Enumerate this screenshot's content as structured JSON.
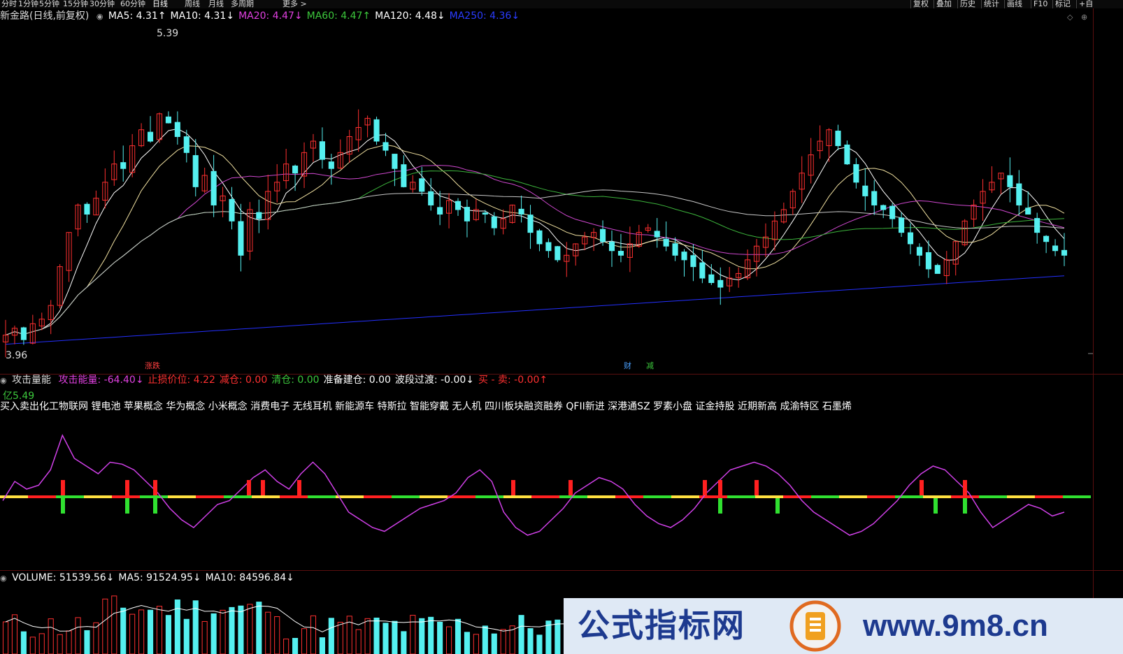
{
  "topbar": {
    "periods": [
      "分时",
      "1分钟",
      "5分钟",
      "15分钟",
      "30分钟",
      "60分钟",
      "日线",
      "周线",
      "月线",
      "多周期",
      "更多 >"
    ],
    "active_period": "日线",
    "right_buttons": [
      "复权",
      "叠加",
      "历史",
      "统计",
      "画线",
      "F10",
      "标记",
      "+自"
    ]
  },
  "main_panel": {
    "title": "新金路(日线,前复权)",
    "indicators": [
      {
        "label": "MA5: 4.31",
        "arrow": "↑",
        "color": "#ffffff"
      },
      {
        "label": "MA10: 4.31",
        "arrow": "↓",
        "color": "#ffffff"
      },
      {
        "label": "MA20: 4.47",
        "arrow": "↓",
        "color": "#e040e0"
      },
      {
        "label": "MA60: 4.47",
        "arrow": "↑",
        "color": "#3cc83c"
      },
      {
        "label": "MA120: 4.48",
        "arrow": "↓",
        "color": "#ffffff"
      },
      {
        "label": "MA250: 4.36",
        "arrow": "↓",
        "color": "#2a3cff"
      }
    ],
    "high_label": "5.39",
    "low_label": "3.96",
    "markers": [
      {
        "text": "涨跌",
        "color": "#ff4040"
      },
      {
        "text": "财",
        "color": "#4aa0ff"
      },
      {
        "text": "减",
        "color": "#3cc83c"
      }
    ]
  },
  "indicator_panel": {
    "name": "攻击量能",
    "items": [
      {
        "label": "攻击能量: -64.40",
        "arrow": "↓",
        "color": "#e040e0"
      },
      {
        "label": "止损价位: 4.22",
        "arrow": "",
        "color": "#ff3030"
      },
      {
        "label": "减仓: 0.00",
        "arrow": "",
        "color": "#ff3030"
      },
      {
        "label": "清仓: 0.00",
        "arrow": "",
        "color": "#3cc83c"
      },
      {
        "label": "准备建仓: 0.00",
        "arrow": "",
        "color": "#ffffff"
      },
      {
        "label": "波段过渡: -0.00",
        "arrow": "↓",
        "color": "#ffffff"
      },
      {
        "label": "买 - 卖: -0.00",
        "arrow": "↑",
        "color": "#ff3030"
      }
    ],
    "concepts": "买入卖出化工物联网 锂电池 苹果概念 华为概念 小米概念 消费电子 无线耳机 新能源车 特斯拉 智能穿戴 无人机 四川板块融资融券 QFII新进 深港通SZ 罗素小盘 证金持股 近期新高 成渝特区 石墨烯",
    "scale_label": "亿5.49"
  },
  "volume_panel": {
    "items": [
      {
        "label": "VOLUME: 51539.56",
        "arrow": "↓",
        "color": "#ffffff"
      },
      {
        "label": "MA5: 91524.95",
        "arrow": "↓",
        "color": "#ffffff"
      },
      {
        "label": "MA10: 84596.84",
        "arrow": "↓",
        "color": "#ffffff"
      }
    ]
  },
  "watermark": {
    "left_text": "公式指标网",
    "right_text": "www.9m8.cn"
  },
  "colors": {
    "up": "#ff3030",
    "down": "#55f0f0",
    "ma5": "#ffffff",
    "ma10": "#f0e0a0",
    "ma20": "#d048d0",
    "ma60": "#3cb43c",
    "ma120": "#c8c8c8",
    "ma250": "#2430ff",
    "energy": "#d040e8"
  },
  "chart_data": [
    {
      "type": "candlestick",
      "title": "新金路(日线,前复权)",
      "ylim": [
        3.96,
        5.39
      ],
      "close": [
        4.05,
        4.08,
        4.03,
        4.1,
        4.12,
        4.18,
        4.35,
        4.5,
        4.62,
        4.58,
        4.65,
        4.72,
        4.8,
        4.78,
        4.88,
        4.95,
        4.9,
        5.02,
        4.98,
        4.92,
        4.85,
        4.7,
        4.75,
        4.62,
        4.66,
        4.55,
        4.4,
        4.6,
        4.56,
        4.68,
        4.72,
        4.8,
        4.76,
        4.85,
        4.9,
        4.82,
        4.78,
        4.85,
        4.92,
        4.96,
        5.0,
        4.9,
        4.86,
        4.78,
        4.7,
        4.72,
        4.68,
        4.62,
        4.58,
        4.64,
        4.6,
        4.55,
        4.6,
        4.58,
        4.52,
        4.56,
        4.62,
        4.58,
        4.5,
        4.45,
        4.42,
        4.38,
        4.4,
        4.45,
        4.48,
        4.5,
        4.46,
        4.42,
        4.4,
        4.45,
        4.5,
        4.52,
        4.48,
        4.44,
        4.4,
        4.38,
        4.35,
        4.3,
        4.28,
        4.26,
        4.3,
        4.32,
        4.38,
        4.44,
        4.48,
        4.55,
        4.6,
        4.68,
        4.76,
        4.84,
        4.9,
        4.95,
        4.88,
        4.8,
        4.72,
        4.66,
        4.62,
        4.6,
        4.56,
        4.5,
        4.45,
        4.4,
        4.34,
        4.32,
        4.38,
        4.46,
        4.55,
        4.62,
        4.68,
        4.72,
        4.76,
        4.7,
        4.62,
        4.58,
        4.5,
        4.46,
        4.42,
        4.4
      ]
    },
    {
      "type": "line",
      "title": "攻击量能",
      "series": [
        {
          "name": "攻击能量",
          "values": [
            -10,
            40,
            20,
            30,
            70,
            160,
            100,
            80,
            60,
            90,
            85,
            70,
            40,
            10,
            -30,
            -60,
            -80,
            -50,
            -20,
            -10,
            20,
            50,
            70,
            40,
            20,
            60,
            90,
            60,
            10,
            -40,
            -60,
            -80,
            -90,
            -70,
            -50,
            -30,
            -20,
            -10,
            10,
            50,
            70,
            40,
            -40,
            -80,
            -100,
            -90,
            -60,
            -30,
            10,
            30,
            50,
            40,
            20,
            -20,
            -50,
            -70,
            -80,
            -60,
            -30,
            10,
            40,
            70,
            80,
            90,
            80,
            60,
            30,
            -10,
            -40,
            -60,
            -80,
            -100,
            -90,
            -70,
            -40,
            -10,
            30,
            60,
            80,
            70,
            40,
            10,
            -40,
            -80,
            -60,
            -40,
            -20,
            -30,
            -50,
            -40
          ]
        },
        {
          "name": "止损价位",
          "values": []
        }
      ]
    },
    {
      "type": "bar",
      "title": "VOLUME",
      "series": [
        {
          "name": "VOLUME",
          "values": []
        }
      ]
    }
  ]
}
